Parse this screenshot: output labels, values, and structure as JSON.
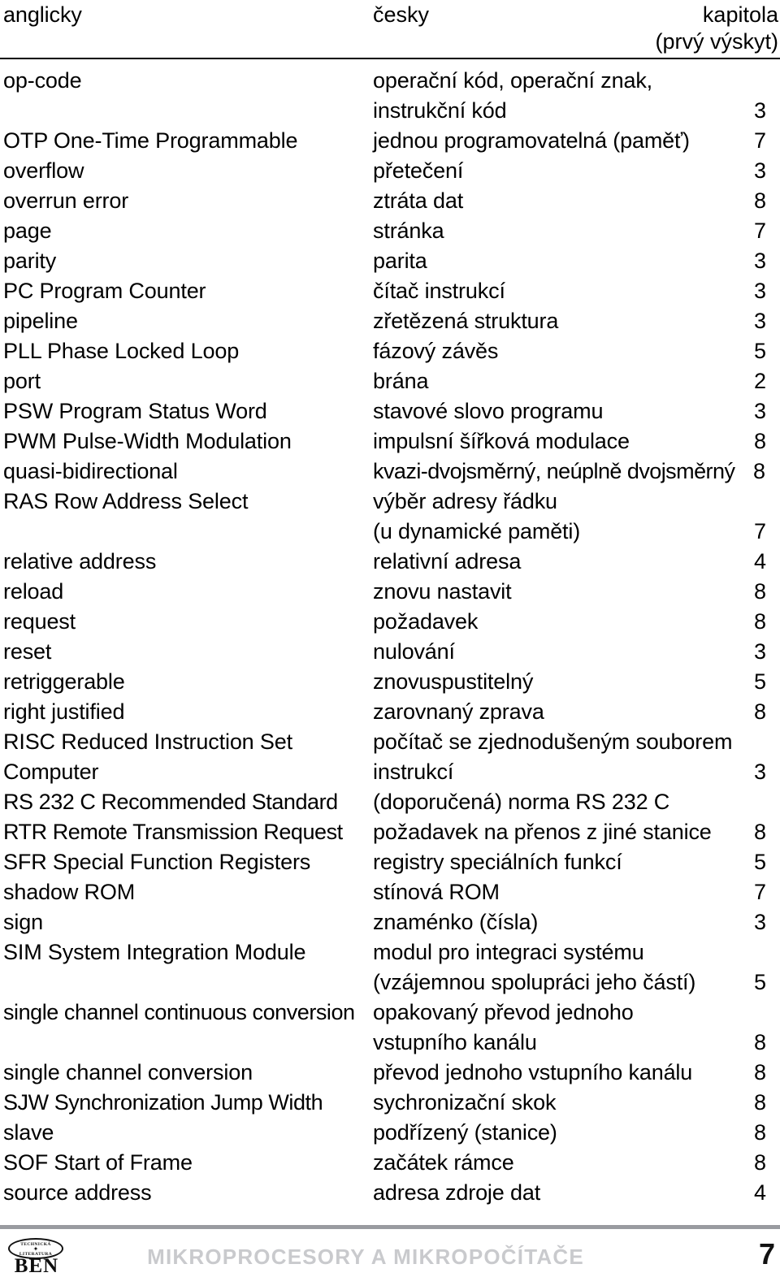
{
  "header": {
    "col_english": "anglicky",
    "col_czech": "česky",
    "col_chapter": "kapitola",
    "col_chapter_note": "(prvý výskyt)"
  },
  "entries": [
    {
      "english": "op-code",
      "czech": "operační kód, operační znak,",
      "chapter": ""
    },
    {
      "english": "",
      "czech": "instrukční kód",
      "chapter": "3"
    },
    {
      "english": "OTP One-Time Programmable",
      "czech": "jednou programovatelná (paměť)",
      "chapter": "7"
    },
    {
      "english": "overflow",
      "czech": "přetečení",
      "chapter": "3"
    },
    {
      "english": "overrun error",
      "czech": "ztráta dat",
      "chapter": "8"
    },
    {
      "english": "page",
      "czech": "stránka",
      "chapter": "7"
    },
    {
      "english": "parity",
      "czech": "parita",
      "chapter": "3"
    },
    {
      "english": "PC Program Counter",
      "czech": "čítač instrukcí",
      "chapter": "3"
    },
    {
      "english": "pipeline",
      "czech": "zřetězená struktura",
      "chapter": "3"
    },
    {
      "english": "PLL Phase Locked Loop",
      "czech": "fázový závěs",
      "chapter": "5"
    },
    {
      "english": "port",
      "czech": "brána",
      "chapter": "2"
    },
    {
      "english": "PSW Program Status Word",
      "czech": "stavové slovo programu",
      "chapter": "3"
    },
    {
      "english": "PWM Pulse-Width Modulation",
      "czech": "impulsní šířková modulace",
      "chapter": "8"
    },
    {
      "english": "quasi-bidirectional",
      "czech": "kvazi-dvojsměrný, neúplně dvojsměrný",
      "chapter": "8",
      "tight": true
    },
    {
      "english": "RAS Row Address Select",
      "czech": "výběr adresy řádku",
      "chapter": ""
    },
    {
      "english": "",
      "czech": "(u dynamické paměti)",
      "chapter": "7"
    },
    {
      "english": "relative address",
      "czech": "relativní adresa",
      "chapter": "4"
    },
    {
      "english": "reload",
      "czech": "znovu nastavit",
      "chapter": "8"
    },
    {
      "english": "request",
      "czech": "požadavek",
      "chapter": "8"
    },
    {
      "english": "reset",
      "czech": "nulování",
      "chapter": "3"
    },
    {
      "english": "retriggerable",
      "czech": "znovuspustitelný",
      "chapter": "5"
    },
    {
      "english": "right justified",
      "czech": "zarovnaný zprava",
      "chapter": "8"
    },
    {
      "english": "RISC Reduced Instruction Set",
      "czech": "počítač se zjednodušeným souborem",
      "chapter": ""
    },
    {
      "english": " Computer",
      "czech": "instrukcí",
      "chapter": "3"
    },
    {
      "english": "RS 232 C  Recommended Standard",
      "czech": "(doporučená) norma RS 232 C",
      "chapter": "",
      "wide_eng": true
    },
    {
      "english": "RTR Remote Transmission Request",
      "czech": "požadavek na přenos z jiné stanice",
      "chapter": "8",
      "wide_eng": true
    },
    {
      "english": "SFR Special Function Registers",
      "czech": "registry speciálních funkcí",
      "chapter": "5"
    },
    {
      "english": "shadow ROM",
      "czech": "stínová ROM",
      "chapter": "7"
    },
    {
      "english": "sign",
      "czech": "znaménko (čísla)",
      "chapter": "3"
    },
    {
      "english": "SIM System Integration Module",
      "czech": "modul pro integraci systému",
      "chapter": ""
    },
    {
      "english": "",
      "czech": "(vzájemnou spolupráci jeho částí)",
      "chapter": "5"
    },
    {
      "english": "single channel continuous conversion",
      "czech": "opakovaný převod jednoho",
      "chapter": "",
      "wide_eng": true
    },
    {
      "english": "",
      "czech": "vstupního kanálu",
      "chapter": "8"
    },
    {
      "english": "single channel conversion",
      "czech": "převod jednoho vstupního kanálu",
      "chapter": "8"
    },
    {
      "english": "SJW Synchronization Jump Width",
      "czech": "sychronizační skok",
      "chapter": "8",
      "wide_eng": true
    },
    {
      "english": "slave",
      "czech": "podřízený (stanice)",
      "chapter": "8"
    },
    {
      "english": "SOF Start of Frame",
      "czech": "začátek rámce",
      "chapter": "8"
    },
    {
      "english": "source address",
      "czech": "adresa zdroje dat",
      "chapter": "4"
    }
  ],
  "footer": {
    "logo_top_text": "TECHNICKÁ",
    "logo_plus": "✦",
    "logo_bottom_text": "LITERATURA",
    "logo_brand": "BEN",
    "book_title": "MIKROPROCESORY A MIKROPOČÍTAČE",
    "page_number": "7",
    "title_color": "#c9cacd",
    "rule_color": "#999ba0"
  }
}
